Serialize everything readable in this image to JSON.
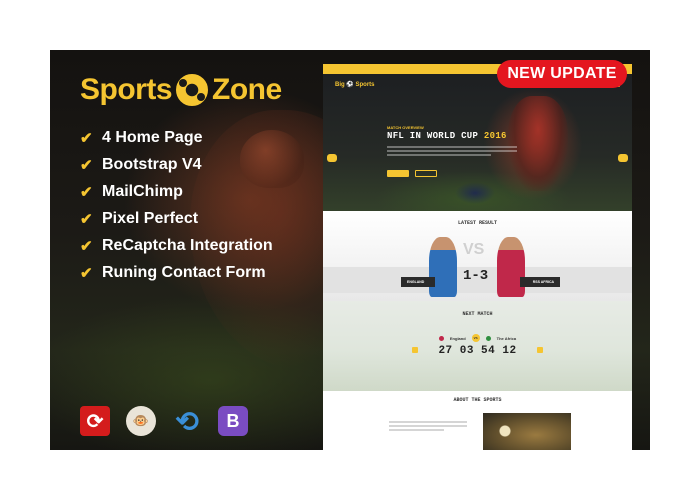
{
  "logo": {
    "word1": "Sports",
    "word2": "Zone",
    "icon": "soccer-ball-icon"
  },
  "features": [
    "4 Home Page",
    "Bootstrap V4",
    "MailChimp",
    "Pixel Perfect",
    "ReCaptcha Integration",
    "Runing Contact Form"
  ],
  "tech_icons": [
    "recaptcha-icon",
    "mailchimp-icon",
    "sync-icon",
    "bootstrap-icon"
  ],
  "badge": "NEW UPDATE",
  "colors": {
    "accent": "#f5c531",
    "badge": "#e4161f",
    "dark": "#141210"
  },
  "preview": {
    "brand_prefix": "Big",
    "brand_suffix": "Sports",
    "hero": {
      "kicker": "MATCH OVERVIEW",
      "title": "NFL IN WORLD CUP",
      "year": "2016"
    },
    "latest": {
      "title": "LATEST RESULT",
      "vs": "VS",
      "score": "1-3",
      "team_left": "ENGLAND",
      "team_right": "RSS AFRICA"
    },
    "next": {
      "title": "NEXT MATCH",
      "team_left": "England",
      "vs": "VS",
      "team_right": "The Africa",
      "countdown": "27 03 54 12"
    },
    "about": {
      "title": "ABOUT THE SPORTS"
    }
  }
}
